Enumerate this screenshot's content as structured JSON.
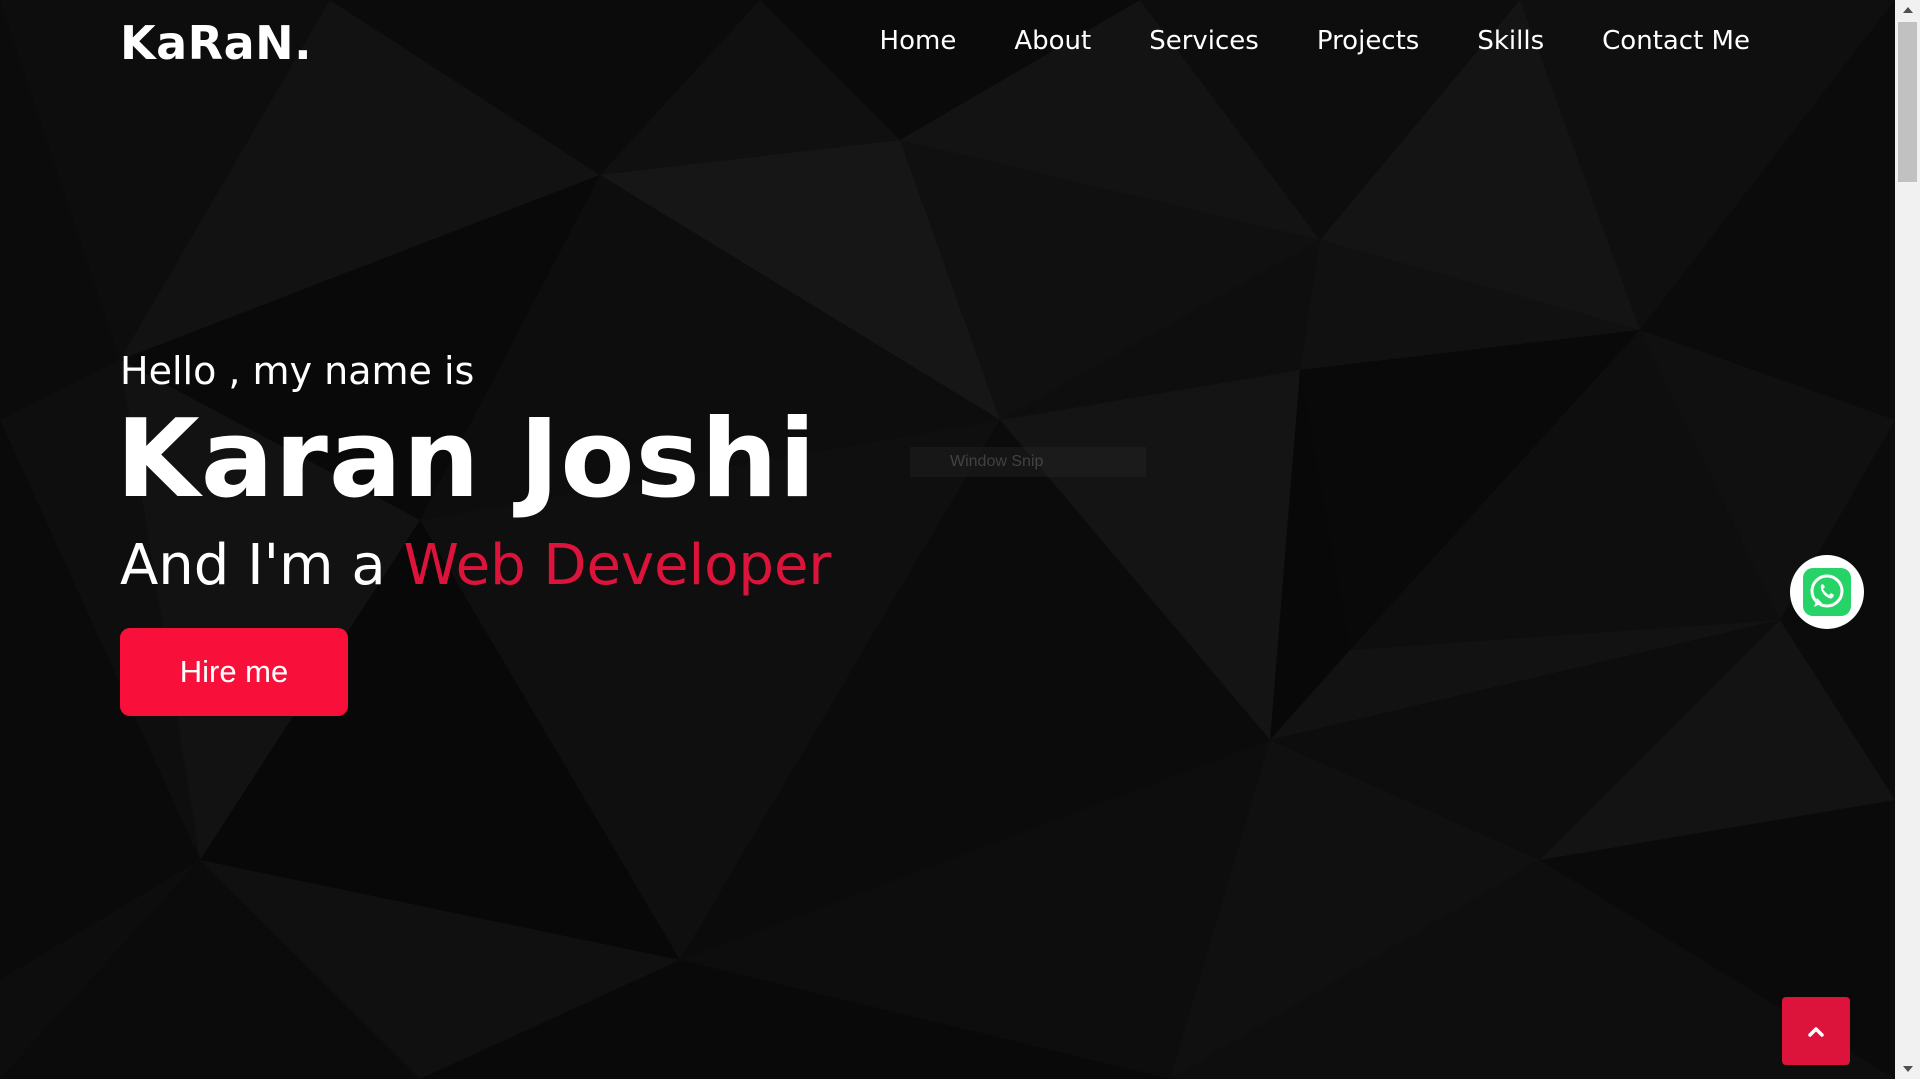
{
  "nav": {
    "logo": "KaRaN.",
    "items": [
      {
        "label": "Home"
      },
      {
        "label": "About"
      },
      {
        "label": "Services"
      },
      {
        "label": "Projects"
      },
      {
        "label": "Skills"
      },
      {
        "label": "Contact Me"
      }
    ]
  },
  "hero": {
    "greeting": "Hello , my name is",
    "name": "Karan Joshi",
    "role_prefix": "And I'm a ",
    "role_highlight": "Web Developer",
    "cta_label": "Hire me"
  },
  "overlay": {
    "snip_label": "Window Snip"
  },
  "icons": {
    "whatsapp": "whatsapp-icon",
    "scroll_top": "chevron-up-icon"
  },
  "colors": {
    "accent": "#dc143c",
    "button": "#f8103a",
    "background": "#0c0c0c",
    "whatsapp_green": "#25d366"
  }
}
